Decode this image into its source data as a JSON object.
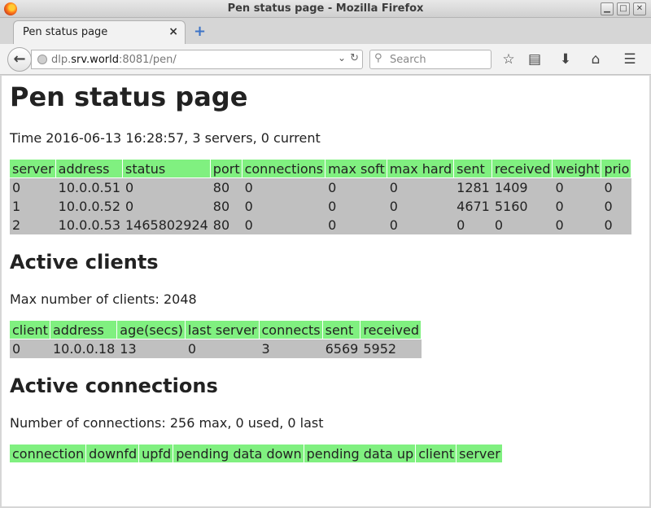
{
  "window": {
    "title": "Pen status page - Mozilla Firefox"
  },
  "tab": {
    "label": "Pen status page",
    "close": "×",
    "new": "+"
  },
  "nav": {
    "url_prefix": "dlp.",
    "url_host": "srv.world",
    "url_suffix": ":8081/pen/",
    "search_placeholder": "Search"
  },
  "page": {
    "title": "Pen status page",
    "time_line": "Time 2016-06-13 16:28:57, 3 servers, 0 current",
    "servers": {
      "headers": [
        "server",
        "address",
        "status",
        "port",
        "connections",
        "max soft",
        "max hard",
        "sent",
        "received",
        "weight",
        "prio"
      ],
      "rows": [
        [
          "0",
          "10.0.0.51",
          "0",
          "80",
          "0",
          "0",
          "0",
          "1281",
          "1409",
          "0",
          "0"
        ],
        [
          "1",
          "10.0.0.52",
          "0",
          "80",
          "0",
          "0",
          "0",
          "4671",
          "5160",
          "0",
          "0"
        ],
        [
          "2",
          "10.0.0.53",
          "1465802924",
          "80",
          "0",
          "0",
          "0",
          "0",
          "0",
          "0",
          "0"
        ]
      ]
    },
    "clients_heading": "Active clients",
    "clients_line": "Max number of clients: 2048",
    "clients": {
      "headers": [
        "client",
        "address",
        "age(secs)",
        "last server",
        "connects",
        "sent",
        "received"
      ],
      "rows": [
        [
          "0",
          "10.0.0.18",
          "13",
          "0",
          "3",
          "6569",
          "5952"
        ]
      ]
    },
    "connections_heading": "Active connections",
    "connections_line": "Number of connections: 256 max, 0 used, 0 last",
    "connections": {
      "headers": [
        "connection",
        "downfd",
        "upfd",
        "pending data down",
        "pending data up",
        "client",
        "server"
      ],
      "rows": []
    }
  },
  "colors": {
    "header_bg": "#80f080",
    "cell_bg": "#c0c0c0"
  },
  "icons": [
    "firefox-logo-icon",
    "back-arrow-icon",
    "globe-icon",
    "dropdown-arrow-icon",
    "reload-icon",
    "search-icon",
    "bookmark-star-icon",
    "reading-list-icon",
    "download-icon",
    "home-icon",
    "hamburger-menu-icon"
  ]
}
